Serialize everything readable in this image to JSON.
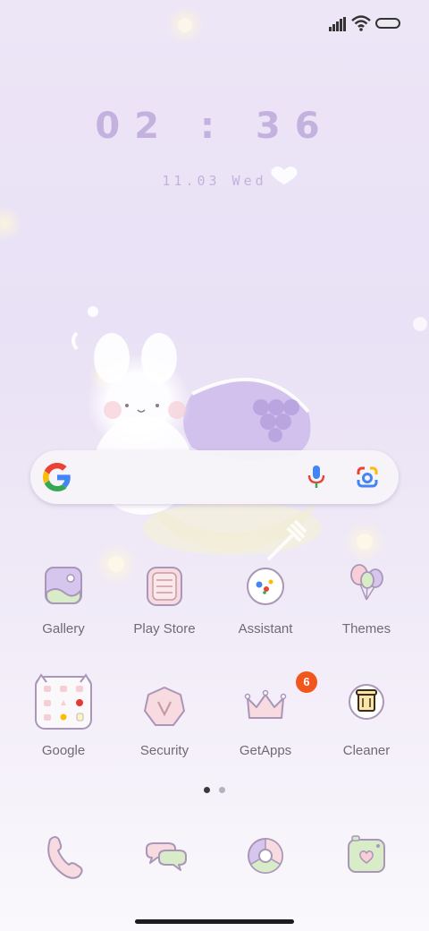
{
  "status_bar": {
    "signal_icon": "signal-icon",
    "wifi_icon": "wifi-icon",
    "battery_icon": "battery-icon"
  },
  "clock": {
    "time": "02 : 36",
    "date": "11.03 Wed"
  },
  "search": {
    "logo_icon": "google-g-icon",
    "mic_icon": "microphone-icon",
    "lens_icon": "google-lens-icon"
  },
  "apps_row1": [
    {
      "label": "Gallery",
      "icon": "gallery-icon"
    },
    {
      "label": "Play Store",
      "icon": "play-store-icon"
    },
    {
      "label": "Assistant",
      "icon": "assistant-icon"
    },
    {
      "label": "Themes",
      "icon": "themes-icon"
    }
  ],
  "apps_row2": [
    {
      "label": "Google",
      "icon": "google-folder-icon"
    },
    {
      "label": "Security",
      "icon": "security-icon"
    },
    {
      "label": "GetApps",
      "icon": "getapps-icon",
      "badge": "6"
    },
    {
      "label": "Cleaner",
      "icon": "cleaner-icon"
    }
  ],
  "page_indicator": {
    "pages": 2,
    "current": 1
  },
  "dock": [
    {
      "icon": "phone-icon"
    },
    {
      "icon": "messages-icon"
    },
    {
      "icon": "browser-icon"
    },
    {
      "icon": "camera-icon"
    }
  ],
  "colors": {
    "accent": "#c4b2de",
    "badge": "#f1571c",
    "label_text": "#6f6a77",
    "icon_stroke": "#a996b8"
  }
}
